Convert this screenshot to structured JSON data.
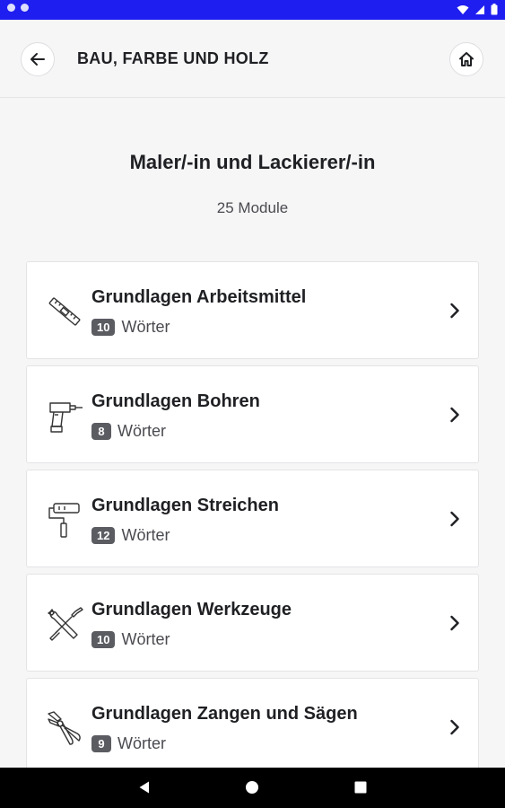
{
  "header": {
    "title": "BAU, FARBE UND HOLZ"
  },
  "page": {
    "title": "Maler/-in und Lackierer/-in",
    "module_count": "25 Module"
  },
  "modules": [
    {
      "title": "Grundlagen Arbeitsmittel",
      "count": "10",
      "unit": "Wörter",
      "icon": "spirit-level-icon"
    },
    {
      "title": "Grundlagen Bohren",
      "count": "8",
      "unit": "Wörter",
      "icon": "drill-icon"
    },
    {
      "title": "Grundlagen Streichen",
      "count": "12",
      "unit": "Wörter",
      "icon": "paint-roller-icon"
    },
    {
      "title": "Grundlagen Werkzeuge",
      "count": "10",
      "unit": "Wörter",
      "icon": "wrench-screwdriver-icon"
    },
    {
      "title": "Grundlagen Zangen und Sägen",
      "count": "9",
      "unit": "Wörter",
      "icon": "pliers-icon"
    }
  ],
  "colors": {
    "status_bar": "#1e1ef0",
    "background": "#f6f6f7",
    "badge": "#5b5c62"
  }
}
